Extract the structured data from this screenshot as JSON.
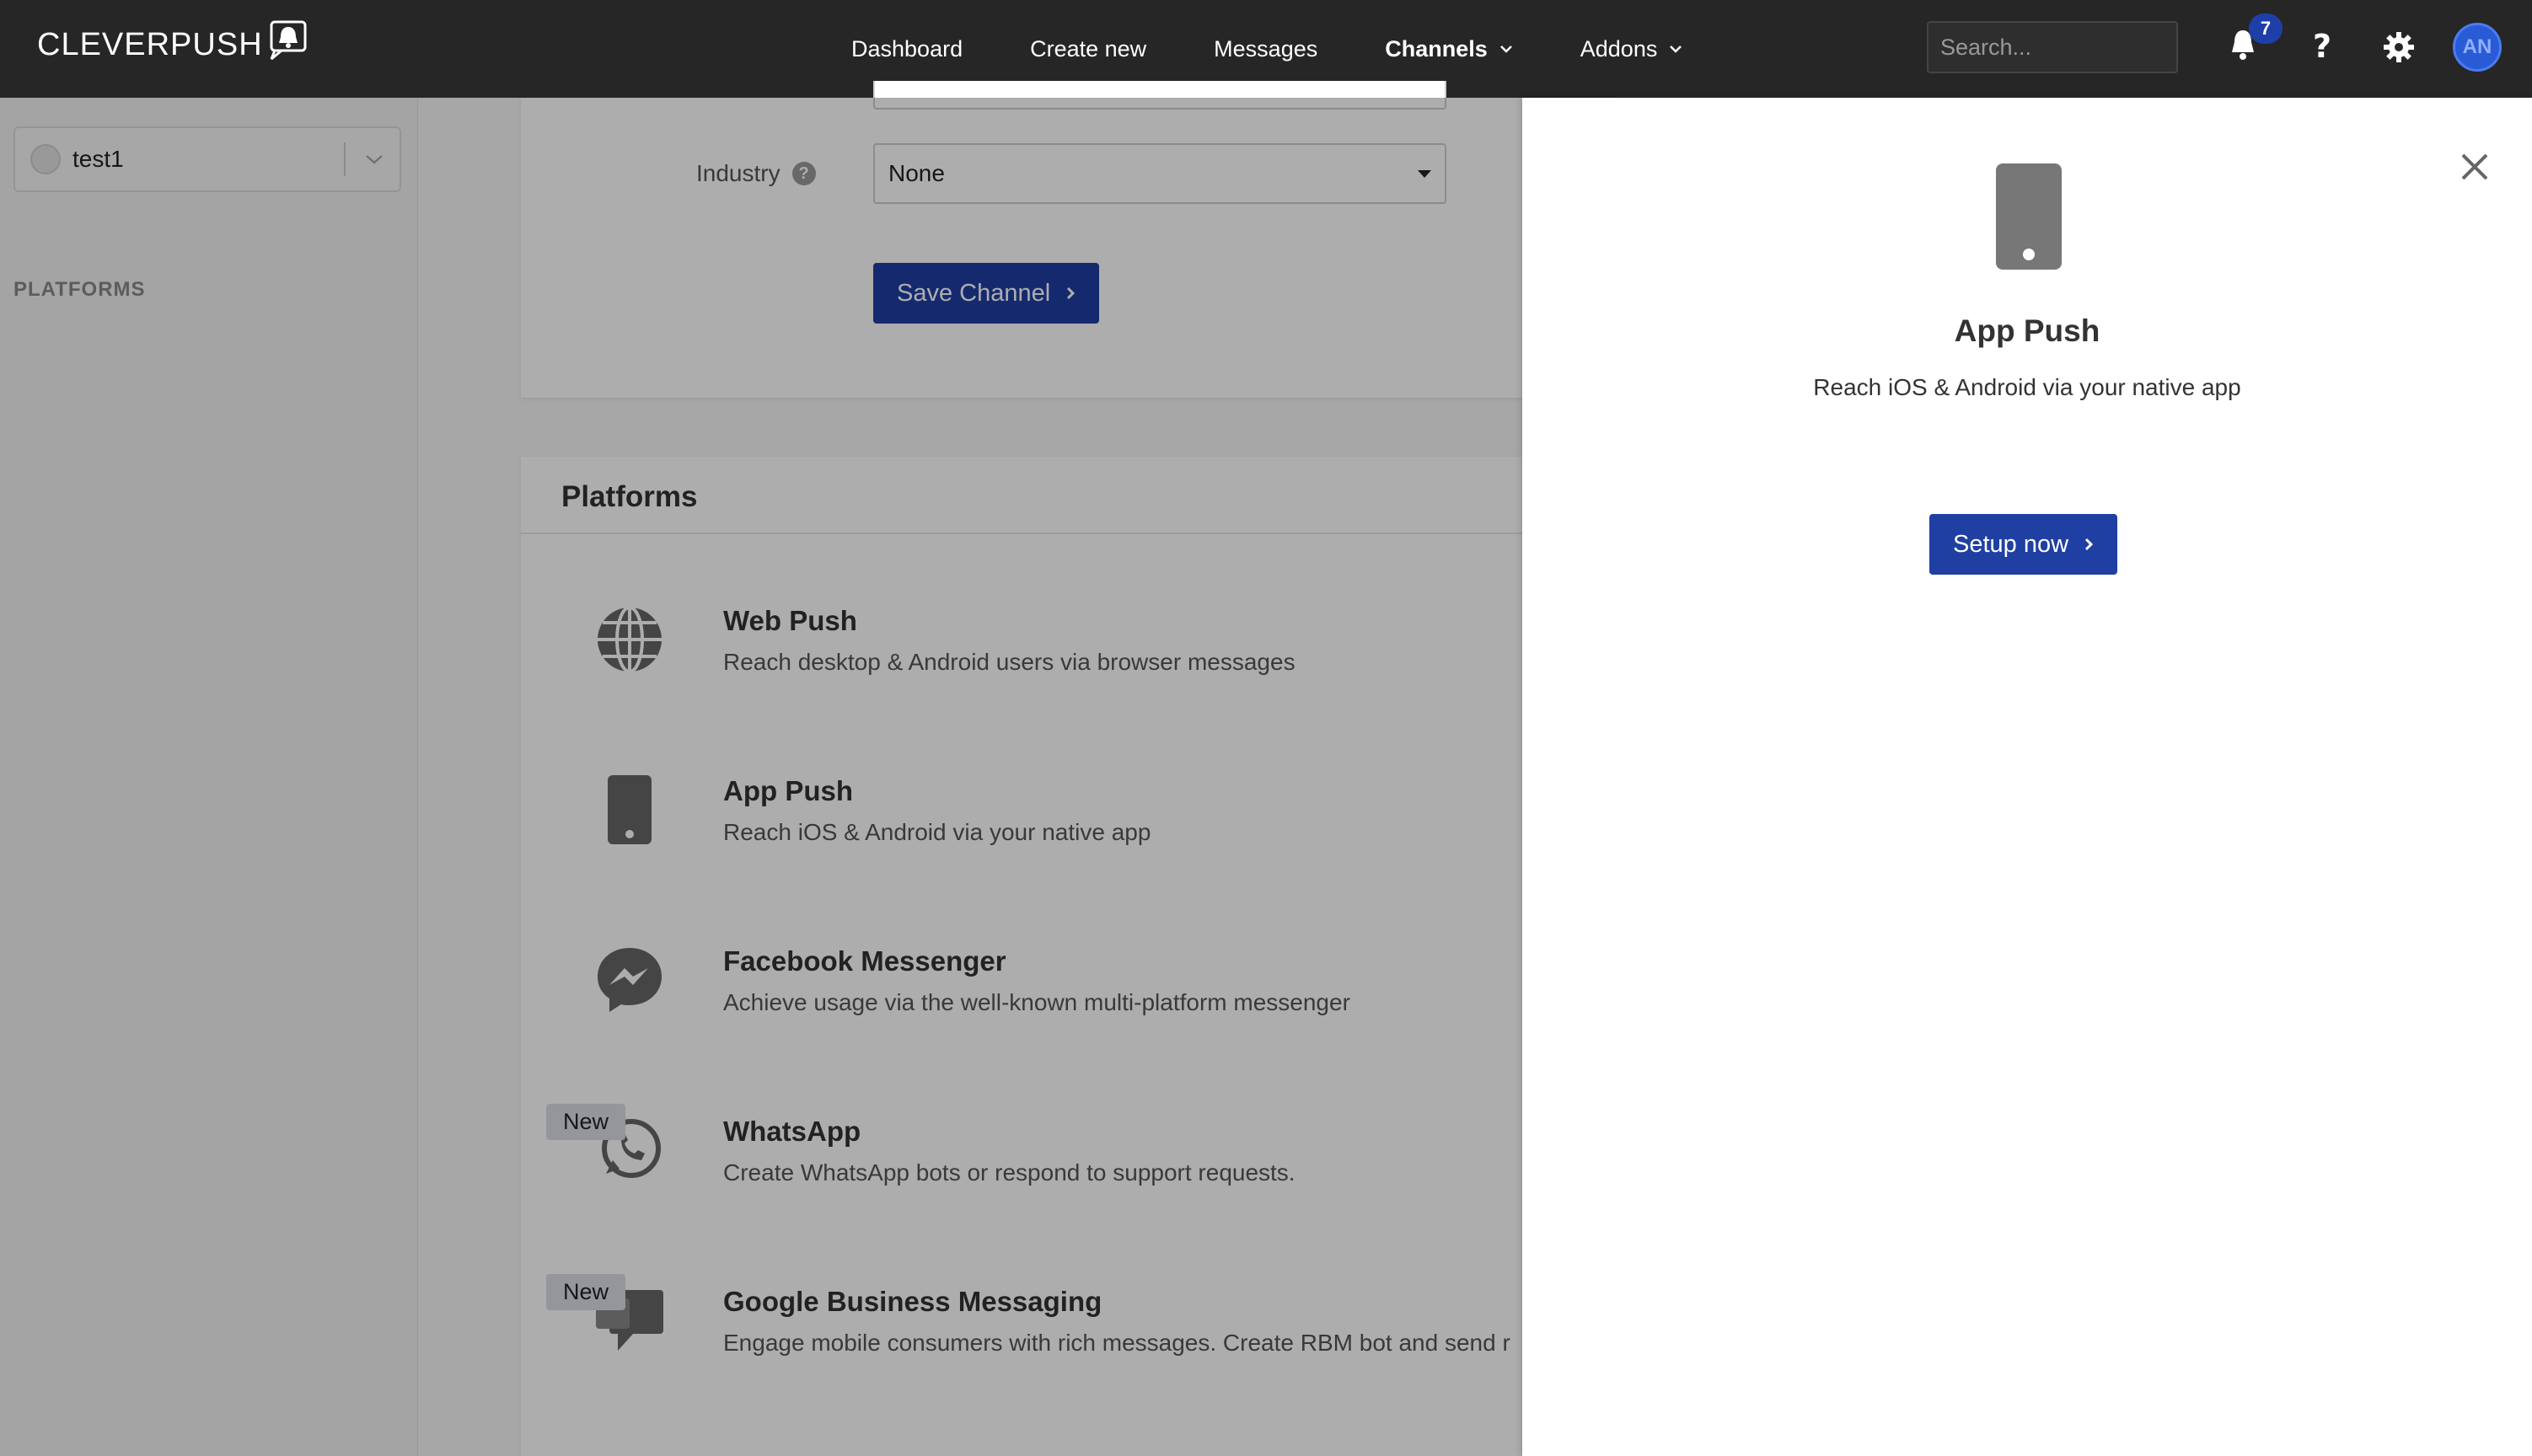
{
  "app": {
    "logo_text": "CLEVERPUSH"
  },
  "nav": {
    "items": [
      {
        "label": "Dashboard"
      },
      {
        "label": "Create new"
      },
      {
        "label": "Messages"
      },
      {
        "label": "Channels"
      },
      {
        "label": "Addons"
      }
    ],
    "search_placeholder": "Search...",
    "notification_count": "7",
    "avatar_initials": "AN"
  },
  "sidebar": {
    "channel_name": "test1",
    "heading": "PLATFORMS"
  },
  "settings_form": {
    "industry_label": "Industry",
    "industry_value": "None",
    "save_label": "Save Channel"
  },
  "platforms": {
    "title": "Platforms",
    "items": [
      {
        "title": "Web Push",
        "desc": "Reach desktop & Android users via browser messages",
        "icon": "globe-icon",
        "badge": ""
      },
      {
        "title": "App Push",
        "desc": "Reach iOS & Android via your native app",
        "icon": "phone-icon",
        "badge": ""
      },
      {
        "title": "Facebook Messenger",
        "desc": "Achieve usage via the well-known multi-platform messenger",
        "icon": "messenger-icon",
        "badge": ""
      },
      {
        "title": "WhatsApp",
        "desc": "Create WhatsApp bots or respond to support requests.",
        "icon": "whatsapp-icon",
        "badge": "New"
      },
      {
        "title": "Google Business Messaging",
        "desc": "Engage mobile consumers with rich messages. Create RBM bot and send r",
        "icon": "chat-bubbles-icon",
        "badge": "New"
      }
    ]
  },
  "panel": {
    "title": "App Push",
    "desc": "Reach iOS & Android via your native app",
    "button_label": "Setup now"
  },
  "colors": {
    "primary": "#1f3fa3",
    "topbar": "#262626",
    "badge": "#1e3fa8"
  }
}
